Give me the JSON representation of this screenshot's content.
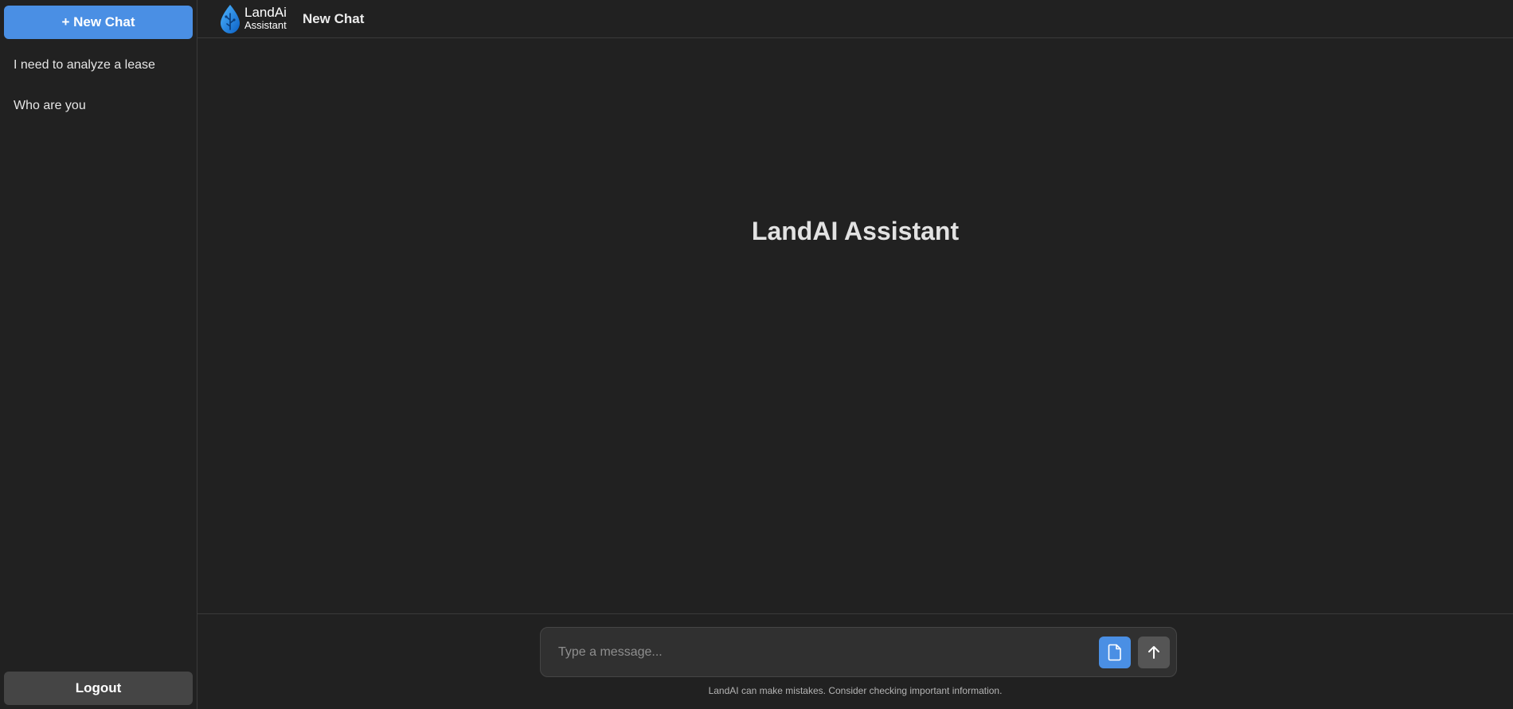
{
  "sidebar": {
    "new_chat_label": "+ New Chat",
    "history": [
      {
        "label": "I need to analyze a lease"
      },
      {
        "label": "Who are you"
      }
    ],
    "logout_label": "Logout"
  },
  "header": {
    "logo_line1": "LandAi",
    "logo_line2": "Assistant",
    "title": "New Chat"
  },
  "main": {
    "hero_title": "LandAI Assistant"
  },
  "composer": {
    "placeholder": "Type a message...",
    "value": "",
    "disclaimer": "LandAI can make mistakes. Consider checking important information."
  },
  "icons": {
    "logo": "water-drop-logo-icon",
    "attach": "document-icon",
    "send": "arrow-up-icon"
  },
  "colors": {
    "accent": "#4a8fe4",
    "background": "#212121",
    "input_bg": "#303030",
    "logout_bg": "#454545"
  }
}
